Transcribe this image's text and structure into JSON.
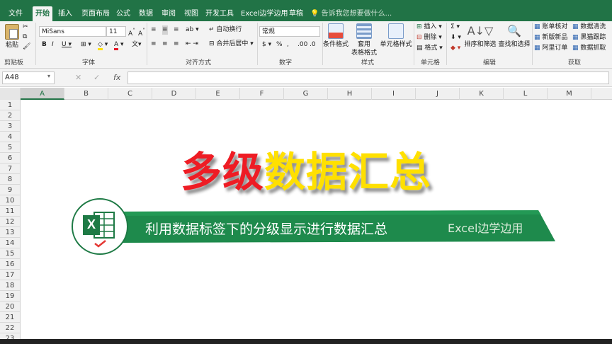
{
  "tabs": {
    "file": "文件",
    "home": "开始",
    "insert": "插入",
    "page_layout": "页面布局",
    "formulas": "公式",
    "data": "数据",
    "review": "审阅",
    "view": "视图",
    "developer": "开发工具",
    "addin": "Excel边学边用",
    "draw": "草稿",
    "tell_me": "告诉我您想要做什么..."
  },
  "ribbon": {
    "clipboard": {
      "paste": "粘贴",
      "label": "剪贴板"
    },
    "font": {
      "name": "MiSans",
      "size": "11",
      "label": "字体"
    },
    "alignment": {
      "wrap": "自动换行",
      "merge": "合并后居中",
      "label": "对齐方式"
    },
    "number": {
      "format": "常规",
      "label": "数字"
    },
    "styles": {
      "conditional": "条件格式",
      "table": "套用\n表格格式",
      "table_l1": "套用",
      "table_l2": "表格格式",
      "cell": "单元格样式",
      "label": "样式"
    },
    "cells": {
      "insert": "插入",
      "delete": "删除",
      "format": "格式",
      "label": "单元格"
    },
    "editing": {
      "sort": "排序和筛选",
      "find": "查找和选择",
      "label": "编辑"
    },
    "acquire": {
      "item1": "账单核对",
      "item2": "新版新品",
      "item3": "阿里订单",
      "item4": "数据清洗",
      "item5": "黑猫跟踪",
      "item6": "数据抓取",
      "label": "获取"
    }
  },
  "formula_bar": {
    "name_box": "A48",
    "fx": "fx"
  },
  "columns": [
    "A",
    "B",
    "C",
    "D",
    "E",
    "F",
    "G",
    "H",
    "I",
    "J",
    "K",
    "L",
    "M"
  ],
  "rows": [
    "1",
    "2",
    "3",
    "4",
    "5",
    "6",
    "7",
    "8",
    "9",
    "10",
    "11",
    "12",
    "13",
    "14",
    "15",
    "16",
    "17",
    "18",
    "19",
    "20",
    "21",
    "22",
    "23"
  ],
  "overlay": {
    "title_red": "多级",
    "title_yellow": "数据汇总",
    "subtitle": "利用数据标签下的分级显示进行数据汇总",
    "brand": "Excel边学边用",
    "logo_letter": "X"
  },
  "colors": {
    "excel_green": "#217346",
    "title_red": "#ee1c24",
    "title_yellow": "#ffe000",
    "banner_green": "#1e8a4c"
  }
}
